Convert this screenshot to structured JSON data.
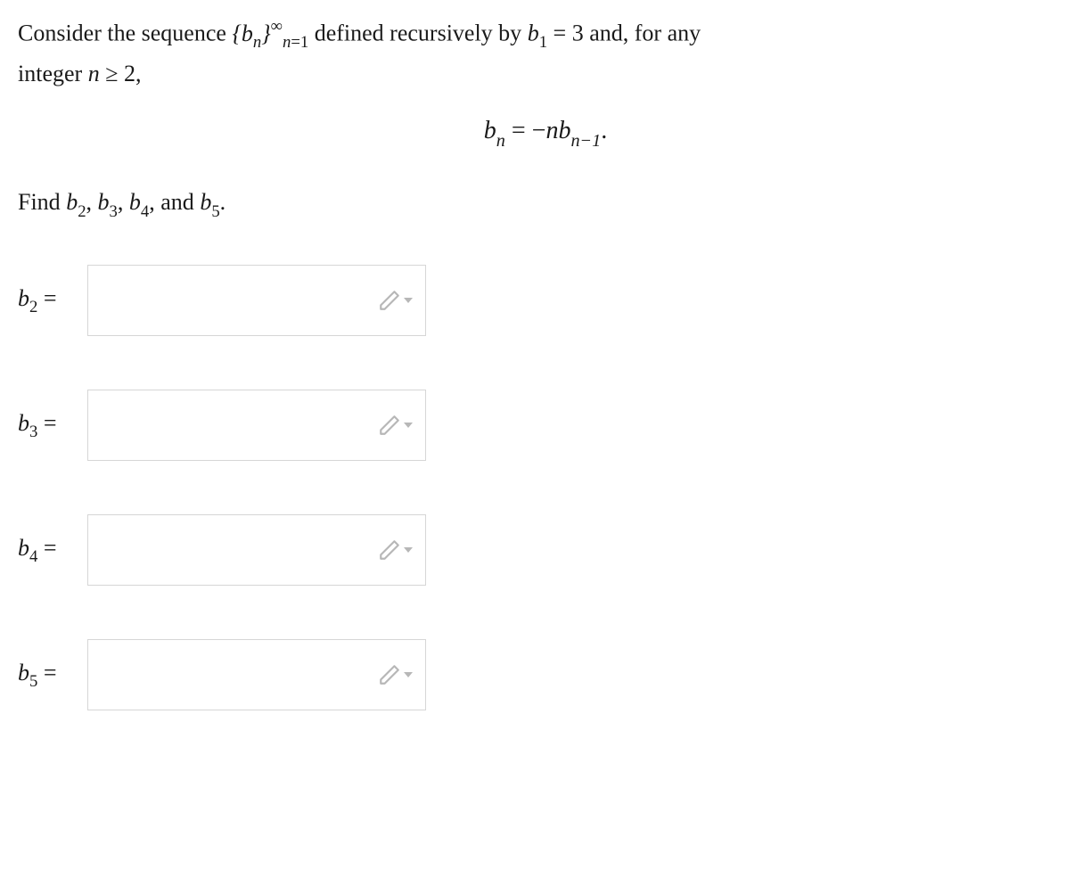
{
  "problem": {
    "line1_pre": "Consider the sequence ",
    "line1_post": " defined recursively by ",
    "b1_equals": " = 3",
    "line1_tail": " and, for any",
    "line2_pre": "integer ",
    "n_ge_2": " ≥ 2,",
    "find_pre": "Find ",
    "find_post": "."
  },
  "formula": {
    "lhs_var": "b",
    "lhs_sub": "n",
    "eq": " = ",
    "rhs_neg": "−",
    "rhs_n": "n",
    "rhs_b": "b",
    "rhs_sub": "n−1",
    "period": "."
  },
  "answers": [
    {
      "label_var": "b",
      "label_sub": "2",
      "value": ""
    },
    {
      "label_var": "b",
      "label_sub": "3",
      "value": ""
    },
    {
      "label_var": "b",
      "label_sub": "4",
      "value": ""
    },
    {
      "label_var": "b",
      "label_sub": "5",
      "value": ""
    }
  ],
  "icons": {
    "pencil": "pencil-icon",
    "caret": "caret-down-icon"
  }
}
